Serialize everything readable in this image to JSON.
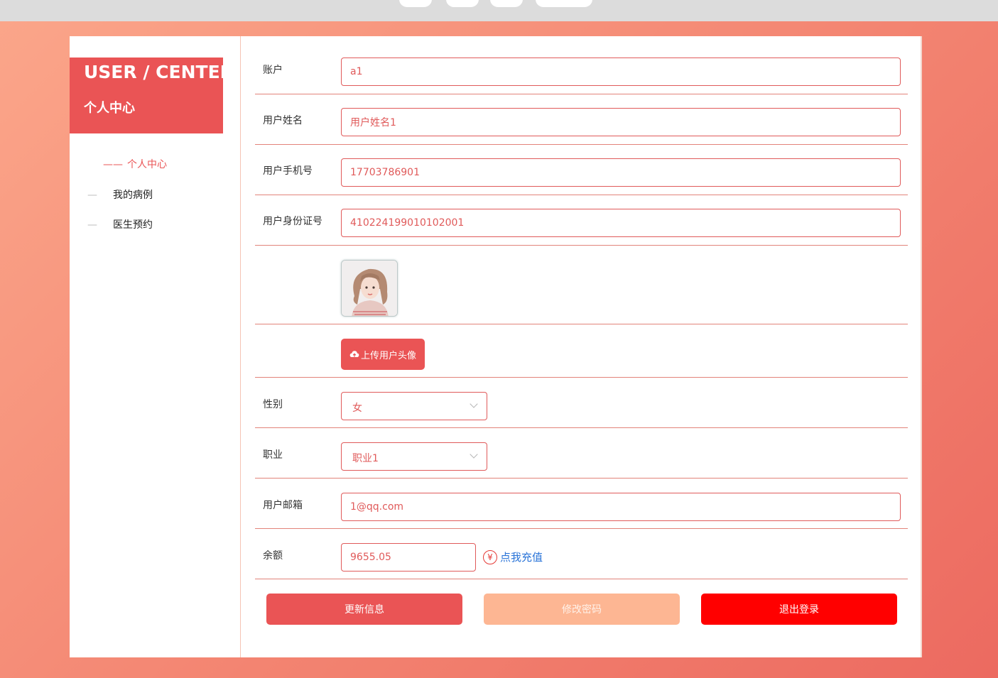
{
  "sidebar": {
    "title_en": "USER / CENTER",
    "title_cn": "个人中心",
    "items": [
      {
        "label": "个人中心",
        "active": true
      },
      {
        "label": "我的病例",
        "active": false
      },
      {
        "label": "医生预约",
        "active": false
      }
    ]
  },
  "form": {
    "account": {
      "label": "账户",
      "value": "a1"
    },
    "name": {
      "label": "用户姓名",
      "value": "用户姓名1"
    },
    "phone": {
      "label": "用户手机号",
      "value": "17703786901"
    },
    "id_card": {
      "label": "用户身份证号",
      "value": "410224199010102001"
    },
    "upload_label": "上传用户头像",
    "gender": {
      "label": "性别",
      "value": "女"
    },
    "occupation": {
      "label": "职业",
      "value": "职业1"
    },
    "email": {
      "label": "用户邮箱",
      "value": "1@qq.com"
    },
    "balance": {
      "label": "余额",
      "value": "9655.05",
      "recharge_label": "点我充值",
      "currency_symbol": "¥"
    }
  },
  "buttons": {
    "update": "更新信息",
    "password": "修改密码",
    "logout": "退出登录"
  },
  "colors": {
    "primary": "#ea5455",
    "secondary": "#fdb693",
    "danger": "#ff0000",
    "link": "#2a74d8"
  }
}
